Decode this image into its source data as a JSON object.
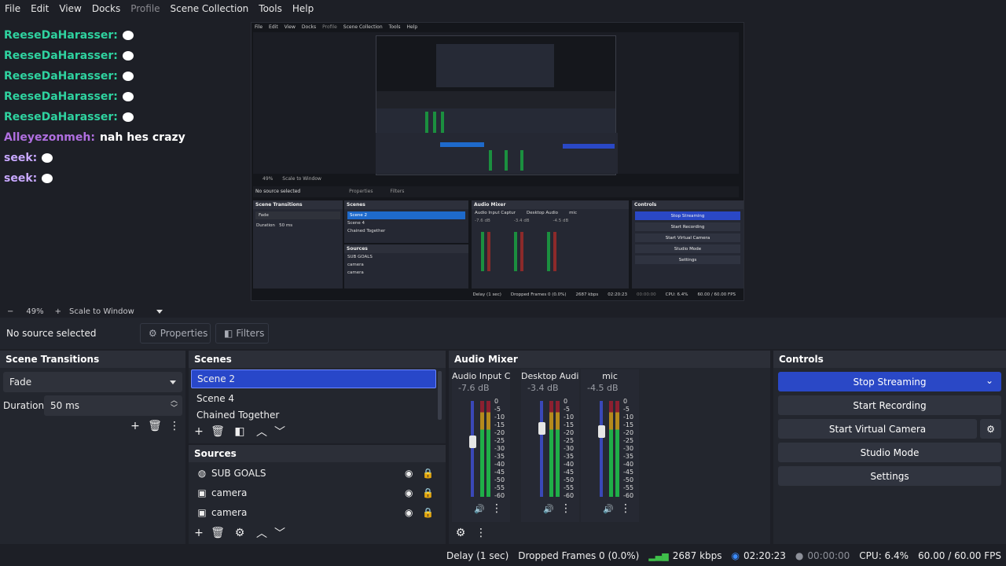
{
  "menu": {
    "items": [
      "File",
      "Edit",
      "View",
      "Docks",
      "Profile",
      "Scene Collection",
      "Tools",
      "Help"
    ]
  },
  "chat": {
    "lines": [
      {
        "user": "ReeseDaHarasser:",
        "color": "#2fd3a0",
        "msg": ""
      },
      {
        "user": "ReeseDaHarasser:",
        "color": "#2fd3a0",
        "msg": ""
      },
      {
        "user": "ReeseDaHarasser:",
        "color": "#2fd3a0",
        "msg": ""
      },
      {
        "user": "ReeseDaHarasser:",
        "color": "#2fd3a0",
        "msg": ""
      },
      {
        "user": "ReeseDaHarasser:",
        "color": "#2fd3a0",
        "msg": ""
      },
      {
        "user": "Alleyezonmeh:",
        "color": "#b06fe0",
        "msg": "nah hes crazy"
      },
      {
        "user": "seek:",
        "color": "#c8a8ff",
        "msg": ""
      },
      {
        "user": "seek:",
        "color": "#c8a8ff",
        "msg": ""
      }
    ]
  },
  "nested": {
    "menu": [
      "File",
      "Edit",
      "View",
      "Docks",
      "Profile",
      "Scene Collection",
      "Tools",
      "Help"
    ],
    "zoom": "49%",
    "scale": "Scale to Window",
    "no_source": "No source selected",
    "properties": "Properties",
    "filters": "Filters",
    "scene_transitions": "Scene Transitions",
    "fade": "Fade",
    "duration_label": "Duration",
    "duration_value": "50 ms",
    "scenes": "Scenes",
    "scene_items": [
      "Scene 2",
      "Scene 4",
      "Chained Together"
    ],
    "sources": "Sources",
    "source_items": [
      "SUB GOALS",
      "camera",
      "camera"
    ],
    "audio_mixer": "Audio Mixer",
    "channels": [
      {
        "name": "Audio Input Captur",
        "db": "-7.6 dB"
      },
      {
        "name": "Desktop Audio",
        "db": "-3.4 dB"
      },
      {
        "name": "mic",
        "db": "-4.5 dB"
      }
    ],
    "controls": "Controls",
    "buttons": [
      "Stop Streaming",
      "Start Recording",
      "Start Virtual Camera",
      "Studio Mode",
      "Settings"
    ],
    "status": [
      "Delay (1 sec)",
      "Dropped Frames 0 (0.0%)",
      "2687 kbps",
      "02:20:23",
      "00:00:00",
      "CPU: 6.4%",
      "60.00 / 60.00 FPS"
    ]
  },
  "zoombar": {
    "minus": "−",
    "zoom": "49%",
    "plus": "+",
    "scale": "Scale to Window"
  },
  "propbar": {
    "no_source": "No source selected",
    "properties": "Properties",
    "filters": "Filters"
  },
  "transitions": {
    "title": "Scene Transitions",
    "selected": "Fade",
    "duration_label": "Duration",
    "duration_value": "50 ms"
  },
  "scenes": {
    "title": "Scenes",
    "items": [
      "Scene 2",
      "Scene 4",
      "Chained Together"
    ],
    "selected_index": 0
  },
  "sources": {
    "title": "Sources",
    "items": [
      {
        "name": "SUB GOALS",
        "icon": "globe-icon"
      },
      {
        "name": "camera",
        "icon": "camera-icon"
      },
      {
        "name": "camera",
        "icon": "camera-icon"
      }
    ]
  },
  "mixer": {
    "title": "Audio Mixer",
    "channels": [
      {
        "name": "Audio Input Captur",
        "db": "-7.6 dB",
        "volume": 0.72
      },
      {
        "name": "Desktop Audio",
        "db": "-3.4 dB",
        "volume": 0.86
      },
      {
        "name": "mic",
        "db": "-4.5 dB",
        "volume": 0.83
      }
    ],
    "scale": [
      "0",
      "-5",
      "-10",
      "-15",
      "-20",
      "-25",
      "-30",
      "-35",
      "-40",
      "-45",
      "-50",
      "-55",
      "-60"
    ]
  },
  "controls": {
    "title": "Controls",
    "stop_streaming": "Stop Streaming",
    "start_recording": "Start Recording",
    "start_virtual_camera": "Start Virtual Camera",
    "studio_mode": "Studio Mode",
    "settings": "Settings"
  },
  "status": {
    "delay": "Delay (1 sec)",
    "dropped": "Dropped Frames 0 (0.0%)",
    "kbps": "2687 kbps",
    "stream_time": "02:20:23",
    "rec_time": "00:00:00",
    "cpu": "CPU: 6.4%",
    "fps": "60.00 / 60.00 FPS"
  },
  "colors": {
    "accent": "#2a48c6",
    "background": "#1d1f26",
    "dock": "#23262e"
  }
}
